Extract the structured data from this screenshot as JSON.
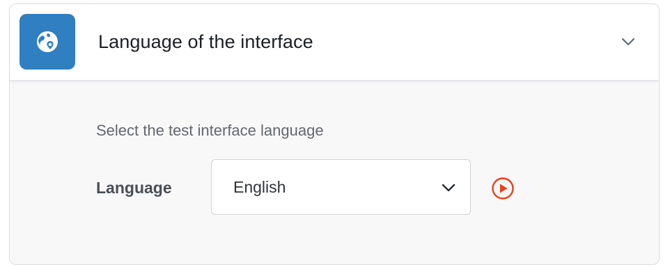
{
  "header": {
    "title": "Language of the interface",
    "icon": "globe-pin-icon",
    "accent_color": "#2f7fc1",
    "collapse_icon": "chevron-down-icon"
  },
  "body": {
    "description": "Select the test interface language",
    "language_field": {
      "label": "Language",
      "selected_value": "English",
      "dropdown_icon": "chevron-down-icon"
    },
    "play_button": {
      "icon": "play-circle-icon",
      "color": "#e8401c"
    }
  }
}
